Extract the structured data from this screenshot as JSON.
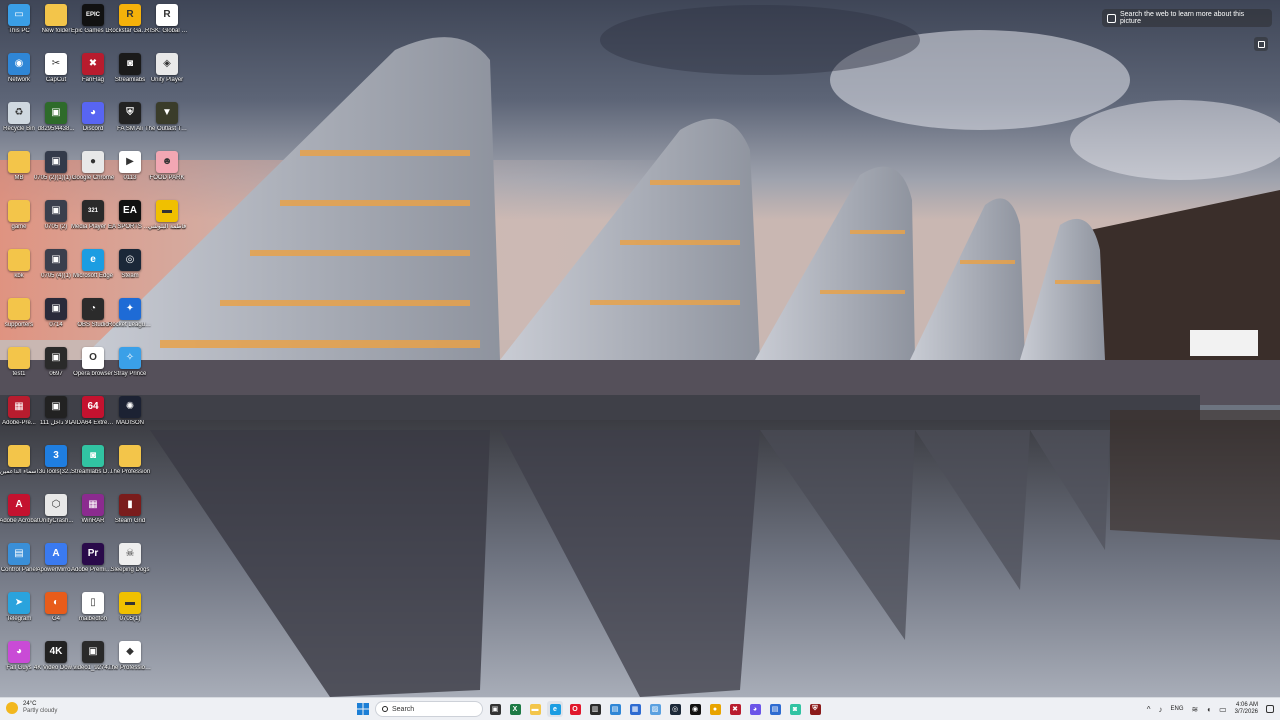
{
  "lens": {
    "prompt": "Search the web to learn more about this picture"
  },
  "desktop_icons": [
    {
      "label": "This PC",
      "color": "#3a9ee6",
      "glyph": "▭",
      "icon": "computer-icon"
    },
    {
      "label": "New folder",
      "color": "#f3c54a",
      "glyph": "",
      "icon": "folder-icon"
    },
    {
      "label": "Epic Games Launcher",
      "color": "#111111",
      "glyph": "EPIC",
      "icon": "epic-games-icon"
    },
    {
      "label": "Rockstar Games Launcher",
      "color": "#f5b10a",
      "glyph": "R",
      "icon": "rockstar-icon"
    },
    {
      "label": "RISK: Global Domination",
      "color": "#ffffff",
      "glyph": "R",
      "icon": "risk-icon"
    },
    {
      "label": "Network",
      "color": "#2f86d6",
      "glyph": "◉",
      "icon": "network-icon"
    },
    {
      "label": "CapCut",
      "color": "#ffffff",
      "glyph": "✂",
      "icon": "capcut-icon"
    },
    {
      "label": "FanFlag",
      "color": "#b81c2e",
      "glyph": "✖",
      "icon": "fanflag-icon"
    },
    {
      "label": "Streamlabs",
      "color": "#1a1a1a",
      "glyph": "◙",
      "icon": "streamlabs-icon"
    },
    {
      "label": "Unity Player",
      "color": "#e8e8e8",
      "glyph": "◈",
      "icon": "unity-icon"
    },
    {
      "label": "Recycle Bin",
      "color": "#cfd8e0",
      "glyph": "♻",
      "icon": "recycle-bin-icon"
    },
    {
      "label": "d8295f4438...",
      "color": "#2e6b2a",
      "glyph": "▣",
      "icon": "image-file-icon"
    },
    {
      "label": "Discord",
      "color": "#5865f2",
      "glyph": "◕",
      "icon": "discord-icon"
    },
    {
      "label": "FA SM Ali",
      "color": "#222222",
      "glyph": "⛨",
      "icon": "shield-game-icon"
    },
    {
      "label": "The Outlast Trials",
      "color": "#3a3c2a",
      "glyph": "▼",
      "icon": "outlast-icon"
    },
    {
      "label": "MB",
      "color": "#f3c54a",
      "glyph": "",
      "icon": "folder-icon"
    },
    {
      "label": "0705 (2)(1)(1)(1)(1)",
      "color": "#333a4a",
      "glyph": "▣",
      "icon": "image-file-icon"
    },
    {
      "label": "Google Chrome",
      "color": "#e8e8e8",
      "glyph": "●",
      "icon": "chrome-icon"
    },
    {
      "label": "0113",
      "color": "#ffffff",
      "glyph": "▶",
      "icon": "video-file-icon"
    },
    {
      "label": "FOOD PARK",
      "color": "#f2a7b3",
      "glyph": "☻",
      "icon": "food-park-icon"
    },
    {
      "label": "game",
      "color": "#f3c54a",
      "glyph": "",
      "icon": "folder-icon"
    },
    {
      "label": "0705 (2)",
      "color": "#3b3f4d",
      "glyph": "▣",
      "icon": "image-file-icon"
    },
    {
      "label": "Media Player Classic",
      "color": "#2a2a2a",
      "glyph": "321",
      "icon": "media-player-icon"
    },
    {
      "label": "EA SPORTS FC™ 25",
      "color": "#111111",
      "glyph": "EA",
      "icon": "ea-fc-icon"
    },
    {
      "label": "فاطمة البلوشي",
      "color": "#f0c000",
      "glyph": "▬",
      "icon": "archive-icon"
    },
    {
      "label": "kbk",
      "color": "#f3c54a",
      "glyph": "",
      "icon": "folder-icon"
    },
    {
      "label": "0705 (4)(1)",
      "color": "#3b3f4d",
      "glyph": "▣",
      "icon": "image-file-icon"
    },
    {
      "label": "Microsoft Edge",
      "color": "#1b9de2",
      "glyph": "e",
      "icon": "edge-icon"
    },
    {
      "label": "Steam",
      "color": "#1b2838",
      "glyph": "◎",
      "icon": "steam-icon"
    },
    {
      "label": "",
      "color": "",
      "glyph": "",
      "icon": ""
    },
    {
      "label": "supporters",
      "color": "#f3c54a",
      "glyph": "",
      "icon": "folder-icon"
    },
    {
      "label": "0714",
      "color": "#2a2a3a",
      "glyph": "▣",
      "icon": "image-file-icon"
    },
    {
      "label": "OBS Studio",
      "color": "#2b2b2b",
      "glyph": "◔",
      "icon": "obs-icon"
    },
    {
      "label": "Rocket League®",
      "color": "#1e6bd6",
      "glyph": "✦",
      "icon": "rocket-league-icon"
    },
    {
      "label": "",
      "color": "",
      "glyph": "",
      "icon": ""
    },
    {
      "label": "test1",
      "color": "#f3c54a",
      "glyph": "",
      "icon": "folder-icon"
    },
    {
      "label": "0697",
      "color": "#2a2a2a",
      "glyph": "▣",
      "icon": "image-file-icon"
    },
    {
      "label": "Opera browser",
      "color": "#ffffff",
      "glyph": "O",
      "icon": "opera-icon"
    },
    {
      "label": "Stray Prince",
      "color": "#3aa0e8",
      "glyph": "✧",
      "icon": "game-icon"
    },
    {
      "label": "",
      "color": "",
      "glyph": "",
      "icon": ""
    },
    {
      "label": "Adobe-Pre...",
      "color": "#b81c2e",
      "glyph": "▦",
      "icon": "archive-icon"
    },
    {
      "label": "بالا داخل 111",
      "color": "#222222",
      "glyph": "▣",
      "icon": "image-file-icon"
    },
    {
      "label": "AIDA64 Extreme",
      "color": "#c4122f",
      "glyph": "64",
      "icon": "aida64-icon"
    },
    {
      "label": "MADISON",
      "color": "#1c2233",
      "glyph": "✺",
      "icon": "madison-icon"
    },
    {
      "label": "",
      "color": "",
      "glyph": "",
      "icon": ""
    },
    {
      "label": "اسماء الداعمين",
      "color": "#f3c54a",
      "glyph": "",
      "icon": "folder-icon"
    },
    {
      "label": "3uTools(32...",
      "color": "#1f7ee0",
      "glyph": "3",
      "icon": "3utools-icon"
    },
    {
      "label": "Streamlabs Desktop",
      "color": "#31c3a2",
      "glyph": "◙",
      "icon": "streamlabs-desktop-icon"
    },
    {
      "label": "The Profession",
      "color": "#f3c54a",
      "glyph": "",
      "icon": "folder-icon"
    },
    {
      "label": "",
      "color": "",
      "glyph": "",
      "icon": ""
    },
    {
      "label": "Adobe Acrobat",
      "color": "#c4122f",
      "glyph": "A",
      "icon": "acrobat-icon"
    },
    {
      "label": "UnityCrash...",
      "color": "#e8e8e8",
      "glyph": "⬡",
      "icon": "unity-crash-icon"
    },
    {
      "label": "WinRAR",
      "color": "#8b2b8f",
      "glyph": "▦",
      "icon": "winrar-icon"
    },
    {
      "label": "Steam Grid",
      "color": "#7a1c1c",
      "glyph": "▮",
      "icon": "game-icon"
    },
    {
      "label": "",
      "color": "",
      "glyph": "",
      "icon": ""
    },
    {
      "label": "Control Panel",
      "color": "#3a8fd8",
      "glyph": "▤",
      "icon": "control-panel-icon"
    },
    {
      "label": "ApowerMirro...",
      "color": "#3a7af0",
      "glyph": "A",
      "icon": "apowermirror-icon"
    },
    {
      "label": "Adobe Premiere P...",
      "color": "#2a0a4a",
      "glyph": "Pr",
      "icon": "premiere-icon"
    },
    {
      "label": "Sleeping Dogs",
      "color": "#eeeeee",
      "glyph": "☠",
      "icon": "skull-icon"
    },
    {
      "label": "",
      "color": "",
      "glyph": "",
      "icon": ""
    },
    {
      "label": "Telegram",
      "color": "#2aa3dd",
      "glyph": "➤",
      "icon": "telegram-icon"
    },
    {
      "label": "G4",
      "color": "#e85c1a",
      "glyph": "◐",
      "icon": "game-icon"
    },
    {
      "label": "malbedfon",
      "color": "#ffffff",
      "glyph": "▯",
      "icon": "document-icon"
    },
    {
      "label": "0705(1)",
      "color": "#f0c000",
      "glyph": "▬",
      "icon": "archive-icon"
    },
    {
      "label": "",
      "color": "",
      "glyph": "",
      "icon": ""
    },
    {
      "label": "Fall Guys",
      "color": "#c94bd6",
      "glyph": "◕",
      "icon": "fall-guys-icon"
    },
    {
      "label": "4K Video Downloader",
      "color": "#222222",
      "glyph": "4K",
      "icon": "4k-downloader-icon"
    },
    {
      "label": "video1_9274...",
      "color": "#2a2a2a",
      "glyph": "▣",
      "icon": "video-file-icon"
    },
    {
      "label": "The Professional",
      "color": "#ffffff",
      "glyph": "◆",
      "icon": "professional-icon"
    },
    {
      "label": "",
      "color": "",
      "glyph": "",
      "icon": ""
    }
  ],
  "taskbar": {
    "weather": {
      "temp": "24°C",
      "condition": "Partly cloudy"
    },
    "search_placeholder": "Search",
    "apps": [
      {
        "icon": "task-view-icon",
        "color": "#333333",
        "glyph": "▣"
      },
      {
        "icon": "excel-icon",
        "color": "#1d7a45",
        "glyph": "X"
      },
      {
        "icon": "file-explorer-icon",
        "color": "#f3c54a",
        "glyph": "▬"
      },
      {
        "icon": "edge-icon",
        "color": "#1b9de2",
        "glyph": "e",
        "active": true
      },
      {
        "icon": "opera-icon",
        "color": "#e0182c",
        "glyph": "O"
      },
      {
        "icon": "app-icon",
        "color": "#2a2a2a",
        "glyph": "▥"
      },
      {
        "icon": "notepad-icon",
        "color": "#2f86d6",
        "glyph": "▤"
      },
      {
        "icon": "calculator-icon",
        "color": "#2e6bd1",
        "glyph": "▦"
      },
      {
        "icon": "photos-icon",
        "color": "#5aa0e0",
        "glyph": "▨"
      },
      {
        "icon": "steam-icon",
        "color": "#1b2838",
        "glyph": "◎"
      },
      {
        "icon": "game-icon",
        "color": "#111111",
        "glyph": "◉"
      },
      {
        "icon": "chrome-icon",
        "color": "#e8a400",
        "glyph": "●"
      },
      {
        "icon": "fanflag-icon",
        "color": "#b81c2e",
        "glyph": "✖"
      },
      {
        "icon": "messenger-icon",
        "color": "#6b55e8",
        "glyph": "◕"
      },
      {
        "icon": "store-icon",
        "color": "#2e6bd1",
        "glyph": "▤"
      },
      {
        "icon": "streamlabs-icon",
        "color": "#31c3a2",
        "glyph": "◙"
      },
      {
        "icon": "shield-game-icon",
        "color": "#8b1a1a",
        "glyph": "⛨"
      }
    ],
    "tray": {
      "lang": "ENG",
      "time": "4:06 AM",
      "date": "3/7/2026"
    }
  }
}
